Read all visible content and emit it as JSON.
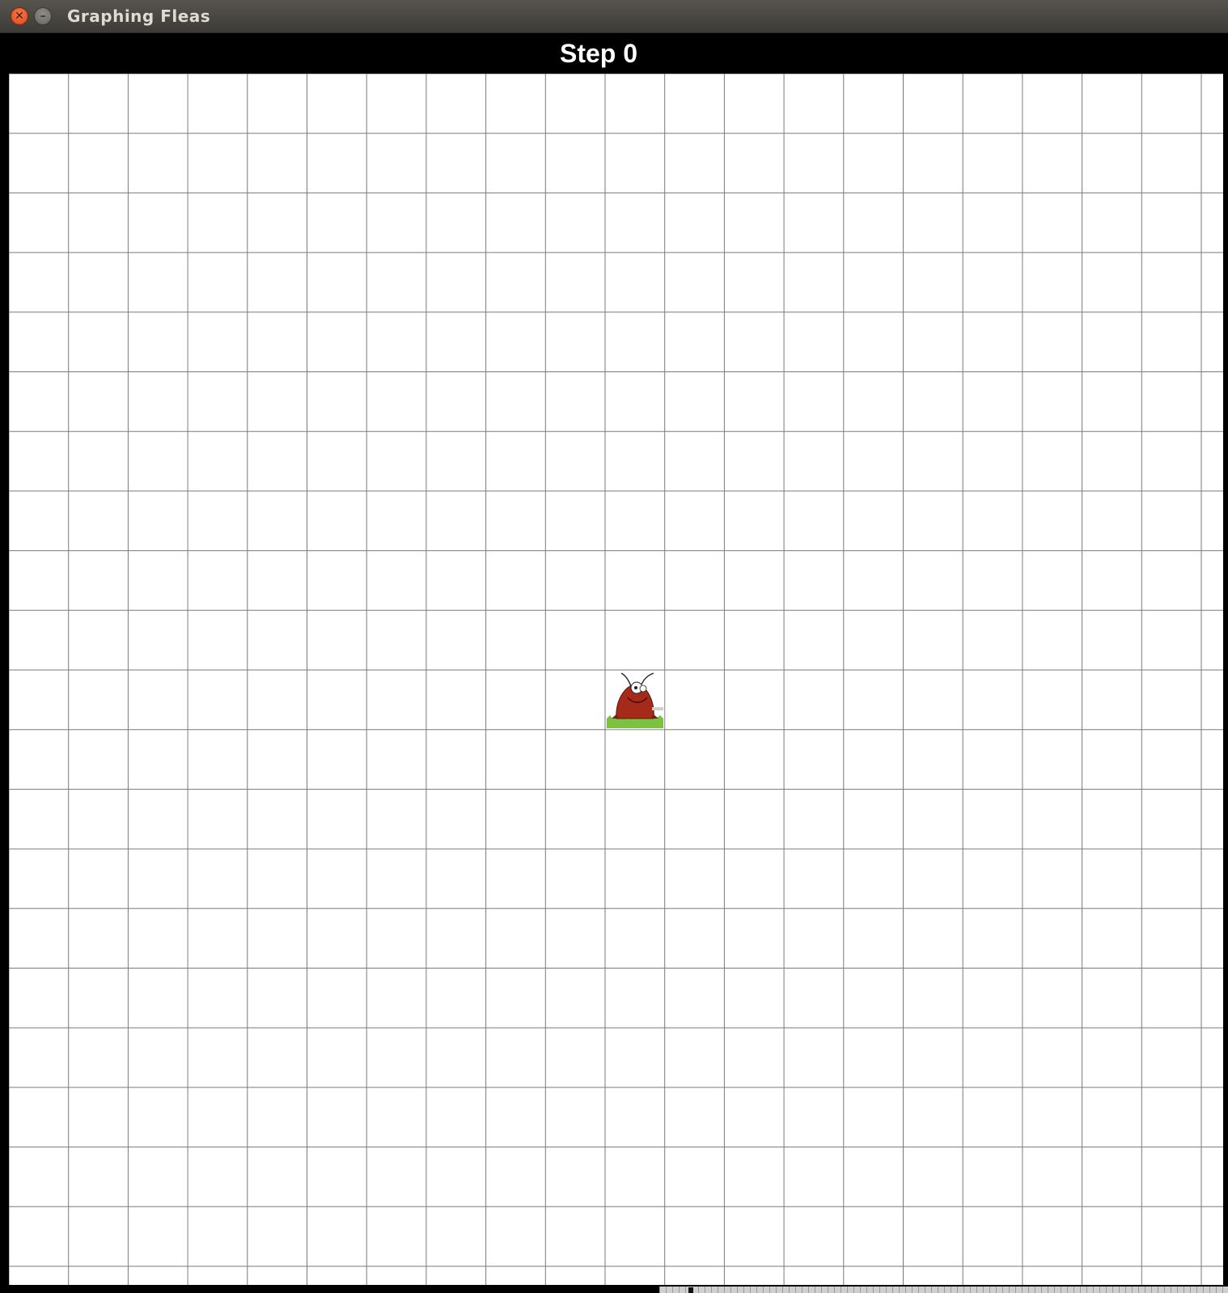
{
  "window": {
    "title": "Graphing Fleas",
    "close_icon": "close-icon",
    "minimize_icon": "minimize-icon"
  },
  "header": {
    "step_label": "Step 0"
  },
  "grid": {
    "columns": 20,
    "rows": 20,
    "line_color": "#7a7a7a",
    "background": "#ffffff"
  },
  "flea": {
    "icon": "flea-icon",
    "column": 10,
    "row": 10,
    "body_color": "#a52a1a",
    "grass_color": "#7cc242"
  }
}
